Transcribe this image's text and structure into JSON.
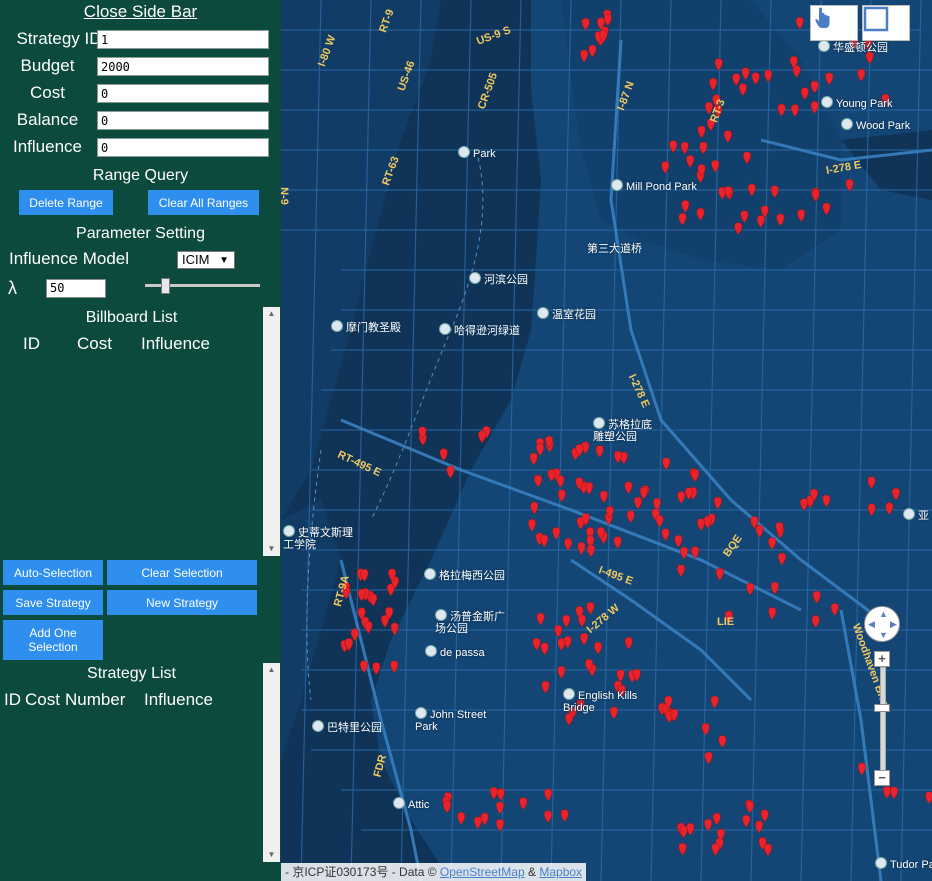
{
  "sidebar": {
    "close_label": "Close Side Bar",
    "fields": {
      "strategy_id": {
        "label": "Strategy ID",
        "value": "1"
      },
      "budget": {
        "label": "Budget",
        "value": "2000"
      },
      "cost": {
        "label": "Cost",
        "value": "0"
      },
      "balance": {
        "label": "Balance",
        "value": "0"
      },
      "influence": {
        "label": "Influence",
        "value": "0"
      }
    },
    "range_query": {
      "title": "Range Query",
      "delete_range": "Delete Range",
      "clear_all_ranges": "Clear All Ranges"
    },
    "parameter": {
      "title": "Parameter Setting",
      "model_label": "Influence Model",
      "model_value": "ICIM",
      "lambda_label": "λ",
      "lambda_value": "50",
      "lambda_slider_level": 0.15
    },
    "billboard_list": {
      "title": "Billboard List",
      "columns": [
        "ID",
        "Cost",
        "Influence"
      ],
      "rows": []
    },
    "buttons": {
      "auto_selection": "Auto-Selection",
      "clear_selection": "Clear Selection",
      "save_strategy": "Save Strategy",
      "new_strategy": "New Strategy",
      "add_one_selection": "Add One Selection"
    },
    "strategy_list": {
      "title": "Strategy List",
      "columns": [
        "ID",
        "Cost",
        "Number",
        "Influence"
      ],
      "rows": []
    }
  },
  "map": {
    "poi_labels": {
      "washington_park": "华盛顿公园",
      "young_park": "Young Park",
      "wood_park": "Wood Park",
      "park": "Park",
      "mill_pond_park": "Mill Pond Park",
      "third_ave_bridge": "第三大道桥",
      "riverside_park": "河滨公园",
      "greenhouse_garden": "温室花园",
      "mormon_temple": "摩门教圣殿",
      "hudson_river_greenway": "哈得逊河绿道",
      "soundview_park": "苏格拉底雕塑公园",
      "stevens_institute": "史蒂文斯理工学院",
      "gramercy_park": "格拉梅西公园",
      "tompkins_square_park": "汤普金斯广场公园",
      "de_passa": "de passa",
      "english_kills_bridge": "English Kills Bridge",
      "john_street_park": "John Street Park",
      "battery_park": "巴特里公园",
      "attic": "Attic",
      "tudor_park": "Tudor Par",
      "asia": "亚"
    },
    "road_labels": {
      "i80_w": "I-80 W",
      "rt9": "RT-9",
      "us9s": "US-9 S",
      "us46": "US-46",
      "cr505": "CR-505",
      "rt63": "RT-63",
      "i87n": "I-87 N",
      "rt3": "RT-3",
      "i278e_top": "I-278 E",
      "i278e_mid": "I-278 E",
      "rt495e": "RT-495 E",
      "i495e": "I-495 E",
      "i278w": "I-278 W",
      "lie": "LIE",
      "rt9a": "RT-9A",
      "woodhaven": "Woodhaven Blvd",
      "fdr": "FDR",
      "n9": "N-9",
      "bqe": "BQE"
    },
    "attribution": {
      "prefix": "- 京ICP证030173号 - Data ©",
      "osm": "OpenStreetMap",
      "amp": "&",
      "mapbox": "Mapbox"
    },
    "tools": [
      "hand-pointer-icon",
      "rectangle-select-icon"
    ],
    "colors": {
      "water": "#0f3457",
      "land": "#12406a",
      "roads": "#2a6aa8",
      "marker": "#e8232b",
      "sidebar": "#0b4a3c",
      "button": "#2f8fef"
    }
  }
}
